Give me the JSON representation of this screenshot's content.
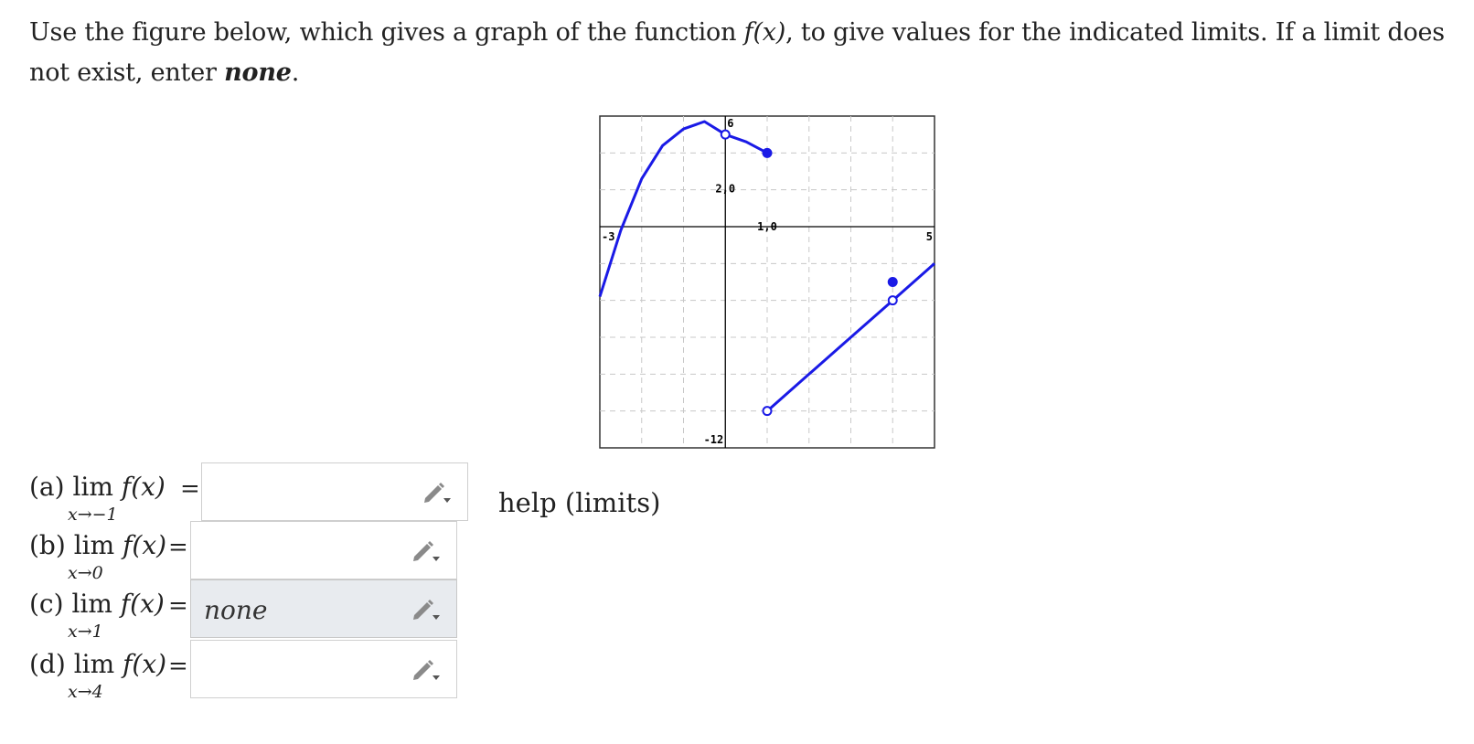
{
  "prompt": {
    "part1": "Use the figure below, which gives a graph of the function ",
    "func": "f(x)",
    "part2": ", to give values for the indicated limits. If a limit does not exist, enter ",
    "none_word": "none",
    "end": "."
  },
  "chart_data": {
    "type": "line",
    "xlim": [
      -3,
      5
    ],
    "ylim": [
      -12,
      6
    ],
    "grid": true,
    "tick_labels": {
      "x_min": "-3",
      "x_max": "5",
      "y_max": "6",
      "y_min": "-12",
      "mark_upper": "2,0",
      "mark_axis": "1,0"
    },
    "series": [
      {
        "segment": "left-curve",
        "x": [
          -3,
          -2.5,
          -2,
          -1.5,
          -1,
          -0.5,
          0,
          0.5,
          1
        ],
        "y": [
          -3.8,
          -0.2,
          2.6,
          4.4,
          5.3,
          5.7,
          5,
          4.6,
          4
        ]
      },
      {
        "segment": "right-line",
        "x": [
          1,
          2,
          3,
          4,
          5
        ],
        "y": [
          -10,
          -8,
          -6,
          -4,
          -2
        ]
      }
    ],
    "points": [
      {
        "x": 0,
        "y": 5,
        "filled": false
      },
      {
        "x": 1,
        "y": 4,
        "filled": true
      },
      {
        "x": 1,
        "y": -10,
        "filled": false
      },
      {
        "x": 4,
        "y": -4,
        "filled": false
      },
      {
        "x": 4,
        "y": -3,
        "filled": true
      }
    ]
  },
  "questions": [
    {
      "part": "(a)",
      "lim": "lim",
      "func": "f(x)",
      "sub": "x→−1",
      "eq": "=",
      "value": ""
    },
    {
      "part": "(b)",
      "lim": "lim",
      "func": "f(x)",
      "sub": "x→0",
      "eq": "=",
      "value": ""
    },
    {
      "part": "(c)",
      "lim": "lim",
      "func": "f(x)",
      "sub": "x→1",
      "eq": "=",
      "value": "none"
    },
    {
      "part": "(d)",
      "lim": "lim",
      "func": "f(x)",
      "sub": "x→4",
      "eq": "=",
      "value": ""
    }
  ],
  "help_link": "help (limits)",
  "colors": {
    "curve": "#1a1ae6",
    "grid": "#c8c8c8",
    "axis": "#000000",
    "filled_box": "#e8ebef",
    "pencil": "#8a8a8a"
  },
  "icons": {
    "pencil": "pencil-dropdown-icon"
  }
}
